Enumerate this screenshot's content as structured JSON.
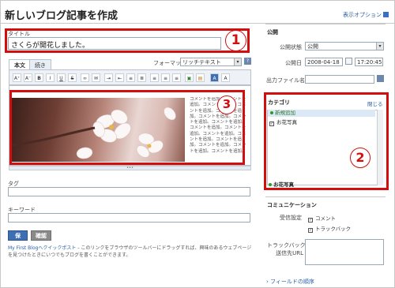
{
  "header": {
    "page_title": "新しいブログ記事を作成",
    "display_options": "表示オプション"
  },
  "editor": {
    "title_label": "タイトル",
    "title_value": "さくらが開花しました。",
    "tabs": [
      {
        "label": "本文"
      },
      {
        "label": "続き"
      }
    ],
    "format_label": "フォーマット:",
    "format_value": "リッチテキスト",
    "toolbar_icons": [
      "font-size-up-icon",
      "font-size-down-icon",
      "bold-icon",
      "italic-icon",
      "underline-icon",
      "strikethrough-icon",
      "link-icon",
      "email-link-icon",
      "indent-icon",
      "outdent-icon",
      "bullet-list-icon",
      "numbered-list-icon",
      "align-left-icon",
      "align-center-icon",
      "align-right-icon",
      "insert-image-icon",
      "insert-file-icon",
      "text-color-icon",
      "font-color-icon",
      "spellcheck-icon"
    ],
    "body_text": "コメントを追加。コメントを追加。コメントを追加。コメントを追加。コメントを追加。コメントを追加。コメントを追加。コメントを追加。コメントを追加。コメントを追加。コメントを追加。コメントを追加。コメントを追加。コメントを追加。コメントを追加。コメントを追加。",
    "resize_glyph": "•••"
  },
  "tags": {
    "label": "タグ",
    "value": ""
  },
  "keywords": {
    "label": "キーワード",
    "value": ""
  },
  "actions": {
    "save": "保存",
    "confirm": "確認"
  },
  "quickpost": {
    "link": "My First Blogへクイックポスト",
    "text": " - このリンクをブラウザのツールバーにドラッグすれば、興味のあるウェブページを見つけたときにいつでもブログを書くことができます。"
  },
  "publish": {
    "title": "公開",
    "status_label": "公開状態",
    "status_value": "公開",
    "date_label": "公開日",
    "date_value": "2008-04-18",
    "time_value": "17:20:45",
    "filename_label": "出力ファイル名",
    "filename_value": ""
  },
  "category": {
    "title": "カテゴリ",
    "close_link": "閉じる",
    "new_label": "新規追加",
    "items": [
      {
        "label": "お花写真",
        "checked": true
      }
    ],
    "selected": "お花写真"
  },
  "communication": {
    "title": "コミュニケーション",
    "accept_label": "受信設定",
    "options": [
      {
        "label": "コメント",
        "checked": true
      },
      {
        "label": "トラックバック",
        "checked": true
      }
    ],
    "trackback_label_1": "トラックバック",
    "trackback_label_2": "送信先URL",
    "trackback_value": ""
  },
  "footer": {
    "fields_order": "フィールドの順序"
  },
  "annotations": [
    "1",
    "2",
    "3"
  ],
  "colors": {
    "annotation_red": "#d10f0f",
    "primary_blue": "#3e6fb3",
    "link_blue": "#2b5fa8"
  }
}
